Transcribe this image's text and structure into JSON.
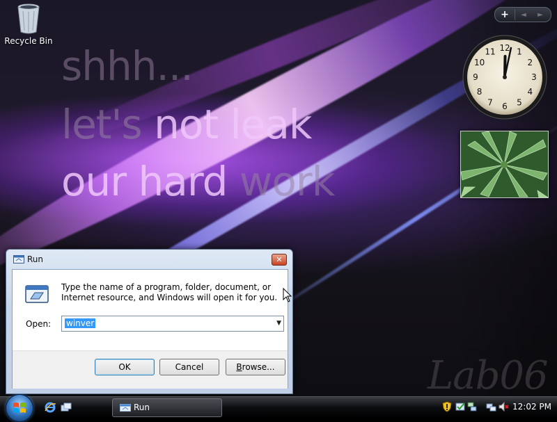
{
  "desktop": {
    "icons": [
      {
        "label": "Recycle Bin",
        "icon": "recycle-bin-icon"
      }
    ],
    "wallpaper_text": {
      "line1": "shhh...",
      "line2_part1": "let's ",
      "line2_part2": "not leak",
      "line3_part1": "our hard ",
      "line3_part2": "work",
      "watermark": "Lab06"
    }
  },
  "gadgets": {
    "controls": {
      "add": "+",
      "prev": "◄",
      "next": "►"
    },
    "clock": {
      "time_hours": 12,
      "time_minutes": 2,
      "numbers": [
        "12",
        "1",
        "2",
        "3",
        "4",
        "5",
        "6",
        "7",
        "8",
        "9",
        "10",
        "11"
      ]
    },
    "slideshow": {
      "icon": "photo-leaves"
    }
  },
  "run_dialog": {
    "title": "Run",
    "description": "Type the name of a program, folder, document, or Internet resource, and Windows will open it for you.",
    "open_label": "Open:",
    "open_value": "winver",
    "buttons": {
      "ok": "OK",
      "cancel": "Cancel",
      "browse_prefix": "B",
      "browse_rest": "rowse..."
    }
  },
  "taskbar": {
    "start_icon": "windows-orb",
    "quick_launch": [
      "internet-explorer-icon",
      "switch-windows-icon"
    ],
    "tasks": [
      {
        "label": "Run",
        "icon": "run-icon"
      }
    ],
    "tray": {
      "icons": [
        "security-shield-icon",
        "windows-update-icon",
        "network-icon",
        "volume-muted-icon"
      ],
      "time": "12:02 PM"
    }
  },
  "colors": {
    "accent": "#3399ff",
    "close": "#c84322"
  }
}
